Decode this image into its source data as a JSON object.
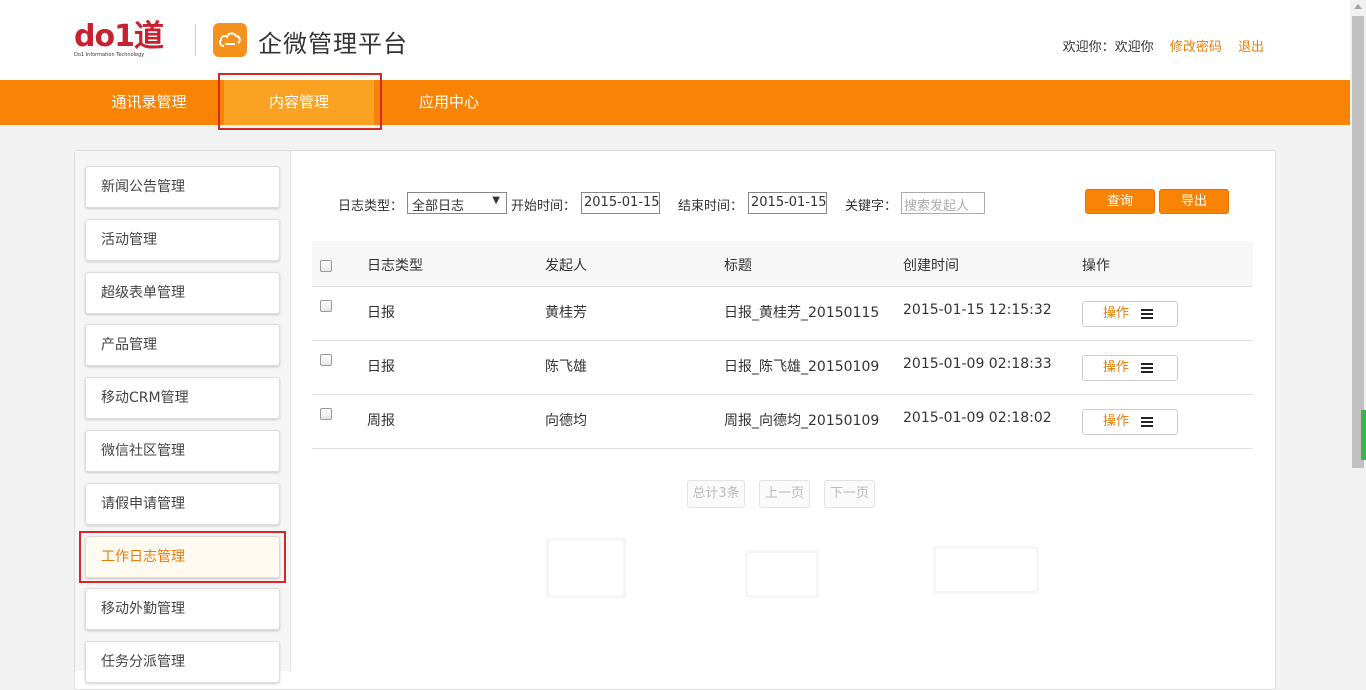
{
  "header": {
    "logo_text": "do1道",
    "logo_subtext": "Do1 Information Technology",
    "app_title": "企微管理平台",
    "welcome": "欢迎你：欢迎你",
    "change_password": "修改密码",
    "logout": "退出"
  },
  "nav": {
    "items": [
      "通讯录管理",
      "内容管理",
      "应用中心"
    ],
    "active": "内容管理"
  },
  "sidebar": {
    "items": [
      "新闻公告管理",
      "活动管理",
      "超级表单管理",
      "产品管理",
      "移动CRM管理",
      "微信社区管理",
      "请假申请管理",
      "工作日志管理",
      "移动外勤管理",
      "任务分派管理"
    ],
    "active": "工作日志管理"
  },
  "filters": {
    "log_type_label": "日志类型：",
    "log_type_value": "全部日志",
    "start_label": "开始时间：",
    "start_value": "2015-01-15",
    "end_label": "结束时间：",
    "end_value": "2015-01-15",
    "keyword_label": "关键字：",
    "keyword_placeholder": "搜索发起人",
    "query_button": "查询",
    "export_button": "导出"
  },
  "table": {
    "headers": [
      "日志类型",
      "发起人",
      "标题",
      "创建时间",
      "操作"
    ],
    "rows": [
      {
        "type": "日报",
        "initiator": "黄桂芳",
        "title": "日报_黄桂芳_20150115",
        "created": "2015-01-15 12:15:32",
        "action": "操作"
      },
      {
        "type": "日报",
        "initiator": "陈飞雄",
        "title": "日报_陈飞雄_20150109",
        "created": "2015-01-09 02:18:33",
        "action": "操作"
      },
      {
        "type": "周报",
        "initiator": "向德均",
        "title": "周报_向德均_20150109",
        "created": "2015-01-09 02:18:02",
        "action": "操作"
      }
    ]
  },
  "pagination": {
    "total": "总计3条",
    "prev": "上一页",
    "next": "下一页"
  },
  "colors": {
    "brand_orange": "#f88305",
    "highlight_red": "#d12a2a"
  }
}
